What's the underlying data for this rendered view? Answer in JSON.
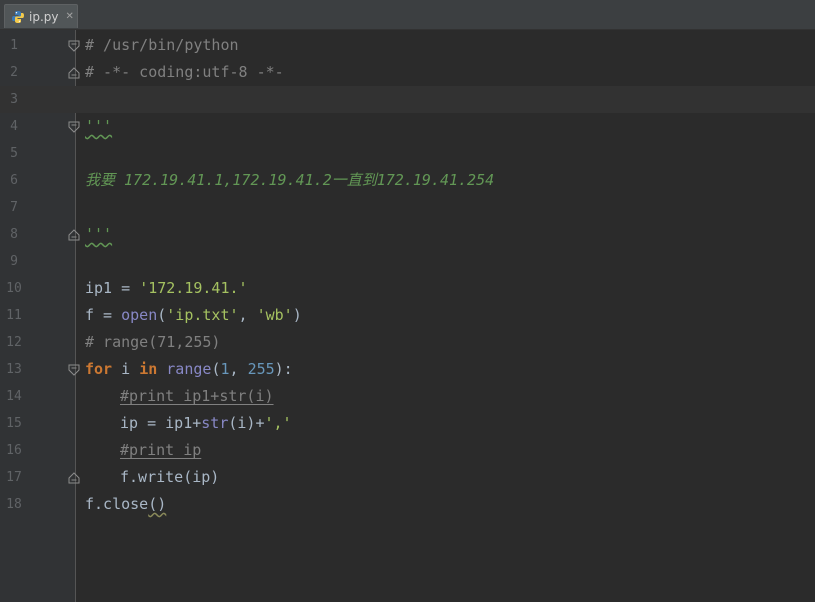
{
  "tab": {
    "filename": "ip.py",
    "close_glyph": "✕"
  },
  "gutter": {
    "line_numbers": [
      "1",
      "2",
      "3",
      "4",
      "5",
      "6",
      "7",
      "8",
      "9",
      "10",
      "11",
      "12",
      "13",
      "14",
      "15",
      "16",
      "17",
      "18"
    ]
  },
  "code": {
    "l1": "# /usr/bin/python",
    "l2": "# -*- coding:utf-8 -*-",
    "l4": "'''",
    "l6": "我要 172.19.41.1,172.19.41.2一直到172.19.41.254",
    "l8": "'''",
    "l10_a": "ip1 = ",
    "l10_b": "'172.19.41.'",
    "l11_a": "f = ",
    "l11_b": "open",
    "l11_c": "(",
    "l11_d": "'ip.txt'",
    "l11_e": ", ",
    "l11_f": "'wb'",
    "l11_g": ")",
    "l12": "# range(71,255)",
    "l13_a": "for",
    "l13_b": " i ",
    "l13_c": "in",
    "l13_d": " ",
    "l13_e": "range",
    "l13_f": "(",
    "l13_g": "1",
    "l13_h": ", ",
    "l13_i": "255",
    "l13_j": "):",
    "l14": "#print ip1+str(i)",
    "l15_a": "ip = ip1+",
    "l15_b": "str",
    "l15_c": "(i)+",
    "l15_d": "','",
    "l16": "#print ip",
    "l17": "f.write(ip)",
    "l18_a": "f.close",
    "l18_b": "()"
  },
  "colors": {
    "background": "#2b2b2b",
    "gutter": "#313335",
    "comment": "#808080",
    "docstring": "#629755",
    "string": "#a5c261",
    "keyword": "#cc7832",
    "builtin": "#8888c6",
    "number": "#6897bb",
    "default_text": "#a9b7c6"
  },
  "current_line": 3,
  "fold_markers": [
    1,
    2,
    4,
    8,
    13,
    17
  ]
}
